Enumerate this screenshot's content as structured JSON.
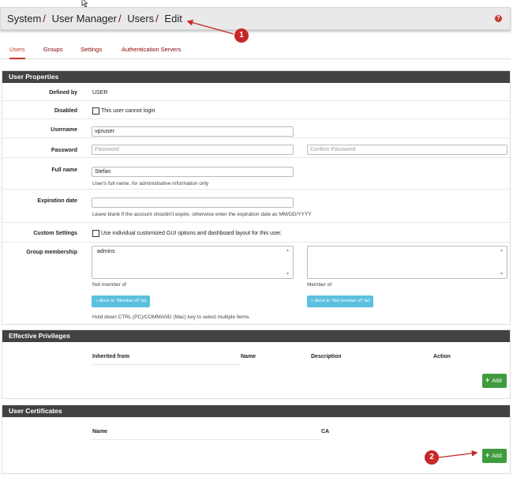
{
  "breadcrumb": [
    "System",
    "User Manager",
    "Users",
    "Edit"
  ],
  "breadcrumb_sep": "/",
  "help_icon": "?",
  "tabs": [
    {
      "label": "Users",
      "active": true
    },
    {
      "label": "Groups",
      "active": false
    },
    {
      "label": "Settings",
      "active": false
    },
    {
      "label": "Authentication Servers",
      "active": false
    }
  ],
  "user_properties": {
    "title": "User Properties",
    "defined_by": {
      "label": "Defined by",
      "value": "USER"
    },
    "disabled": {
      "label": "Disabled",
      "checkbox_label": "This user cannot login"
    },
    "username": {
      "label": "Username",
      "value": "vpnuser"
    },
    "password": {
      "label": "Password",
      "placeholder": "Password",
      "confirm_placeholder": "Confirm Password"
    },
    "full_name": {
      "label": "Full name",
      "value": "Stefan",
      "help": "User's full name, for administrative information only"
    },
    "expiration": {
      "label": "Expiration date",
      "value": "",
      "help": "Leave blank if the account shouldn't expire, otherwise enter the expiration date as MM/DD/YYYY"
    },
    "custom_settings": {
      "label": "Custom Settings",
      "checkbox_label": "Use individual customized GUI options and dashboard layout for this user."
    },
    "group_membership": {
      "label": "Group membership",
      "not_member_items": [
        "admins"
      ],
      "member_items": [],
      "not_member_label": "Not member of",
      "member_label": "Member of",
      "move_to_member": "Move to \"Member of\" list",
      "move_to_not_member": "Move to \"Not member of\" list",
      "help": "Hold down CTRL (PC)/COMMAND (Mac) key to select multiple items."
    }
  },
  "effective_privileges": {
    "title": "Effective Privileges",
    "columns": [
      "Inherited from",
      "Name",
      "Description",
      "Action"
    ],
    "add_label": "Add"
  },
  "user_certificates": {
    "title": "User Certificates",
    "columns": [
      "Name",
      "CA"
    ],
    "add_label": "Add"
  },
  "annotations": [
    "1",
    "2"
  ],
  "colors": {
    "accent": "#8b0000",
    "panel_header": "#424242",
    "add_button": "#3e9b3e",
    "info_button": "#5bc0de",
    "annotation": "#c62828"
  }
}
